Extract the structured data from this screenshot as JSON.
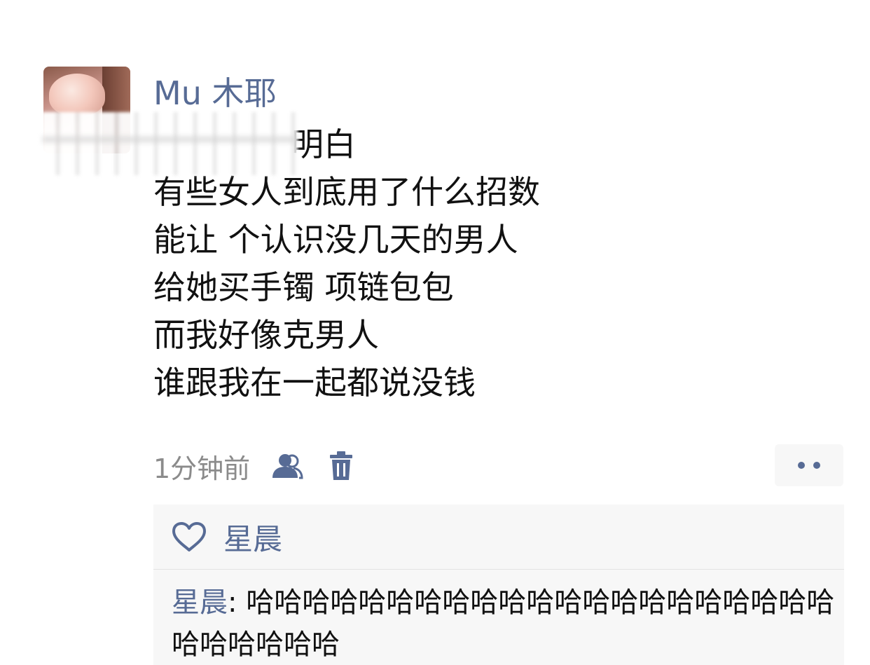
{
  "post": {
    "username": "Mu 木耶",
    "lines": [
      "明白",
      "有些女人到底用了什么招数",
      "能让 个认识没几天的男人",
      "给她买手镯 项链包包",
      "而我好像克男人",
      "谁跟我在一起都说没钱"
    ],
    "timestamp": "1分钟前",
    "icons": {
      "privacy": "friends-visibility-icon",
      "delete": "trash-icon",
      "more": "more-dots-icon",
      "like": "heart-icon"
    }
  },
  "likes": {
    "names": "星晨"
  },
  "comments": [
    {
      "author": "星晨",
      "separator": ": ",
      "text": "哈哈哈哈哈哈哈哈哈哈哈哈哈哈哈哈哈哈哈哈哈哈哈哈哈哈哈"
    }
  ],
  "colors": {
    "link": "#576b95",
    "text": "#111111",
    "meta": "#8b8b8b",
    "panel": "#f7f7f7"
  }
}
